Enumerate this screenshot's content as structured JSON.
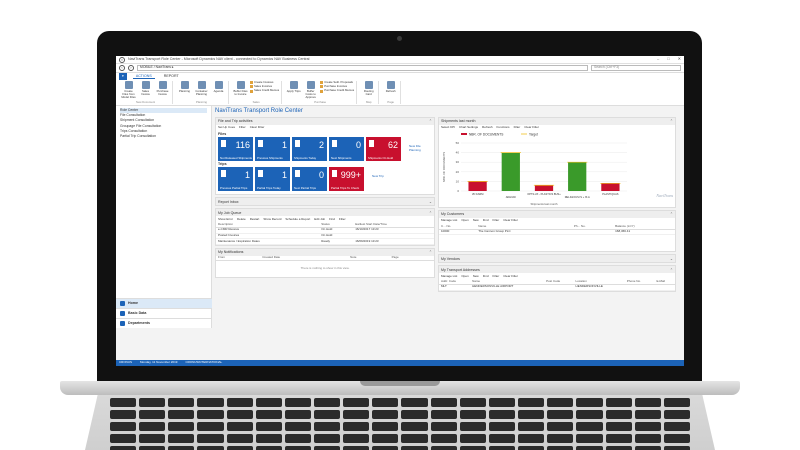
{
  "window": {
    "title": "NaviTrans Transport Role Center - Microsoft Dynamics NAV client - connected to Dynamics NAV Business Central",
    "address": "MOBILE / NaviTrans ▸",
    "search_placeholder": "Search (Ctrl+F3)"
  },
  "ribbon": {
    "tabs": [
      "ACTIONS",
      "REPORT"
    ],
    "groups": [
      {
        "name": "New Document",
        "buttons": [
          "Create Files from Model Files",
          "Sales Invoice",
          "Purchase Invoice"
        ]
      },
      {
        "name": "Planning",
        "buttons": [
          "Planning",
          "Container Planning",
          "Agenda"
        ]
      },
      {
        "name": "Sales",
        "buttons": [
          "Buffer Files to Invoice"
        ],
        "small": [
          "Create Invoices",
          "Sales Invoices",
          "Sales Credit Memos"
        ]
      },
      {
        "name": "Purchase",
        "buttons": [
          "Apply Trips",
          "Buffer Costs to Approve"
        ],
        "small": [
          "Create Settl. Proposals",
          "Purchase Invoices",
          "Purchase Credit Memos"
        ]
      },
      {
        "name": "Map",
        "buttons": [
          "Routing Card"
        ]
      },
      {
        "name": "Page",
        "buttons": [
          "Refresh"
        ]
      }
    ]
  },
  "sidebar": {
    "items": [
      "Role Center",
      "File Consultation",
      "Shipment Consultation",
      "Groupage File Consultation",
      "Trips Consultation",
      "Partial Trip Consultation"
    ],
    "bottom": [
      "Home",
      "Basic Data",
      "Departments"
    ]
  },
  "page_title": "NaviTrans Transport Role Center",
  "file_trip": {
    "header": "File and Trip activities",
    "actions": [
      "Set Up Cues",
      "Filter",
      "Clear Filter"
    ],
    "files_label": "Files",
    "files_tiles": [
      {
        "value": "116",
        "label": "Not Released Shipments",
        "color": "#1c63b7"
      },
      {
        "value": "1",
        "label": "Previous Shipments",
        "color": "#1c63b7"
      },
      {
        "value": "2",
        "label": "Shipments Today",
        "color": "#1c63b7"
      },
      {
        "value": "0",
        "label": "Next Shipments",
        "color": "#1c63b7"
      },
      {
        "value": "62",
        "label": "Shipments On Hold",
        "color": "#c8102e"
      }
    ],
    "files_link": "New File Planning",
    "trips_label": "Trips",
    "trips_tiles": [
      {
        "value": "1",
        "label": "Previous Partial Trips",
        "color": "#1c63b7"
      },
      {
        "value": "1",
        "label": "Partial Trips Today",
        "color": "#1c63b7"
      },
      {
        "value": "0",
        "label": "Next Partial Trips",
        "color": "#1c63b7"
      },
      {
        "value": "999+",
        "label": "Partial Trips To Check",
        "color": "#c8102e"
      }
    ],
    "trips_link": "New Trip"
  },
  "report_inbox": {
    "header": "Report Inbox"
  },
  "job_queue": {
    "header": "My Job Queue",
    "actions": [
      "Show Error",
      "Delete",
      "Restart",
      "Show Record",
      "Schedule a Report",
      "Edit Job",
      "Find",
      "Filter"
    ],
    "columns": [
      "Description",
      "Status",
      "Earliest Start Date/Time"
    ],
    "rows": [
      [
        "e-CMR Receive",
        "On Hold",
        "16/10/2017 13:23"
      ],
      [
        "Posted Invoices",
        "On Hold",
        ""
      ],
      [
        "Maintenance / Expiration Dates",
        "Ready",
        "16/09/2019 13:23"
      ]
    ]
  },
  "notifications": {
    "header": "My Notifications",
    "columns": [
      "From",
      "Created Date",
      "Note",
      "Page"
    ],
    "empty": "There is nothing to show in this view."
  },
  "shipments_chart": {
    "header": "Shipments last month",
    "actions": [
      "Select KPI",
      "Chart Settings",
      "Refresh",
      "Functions",
      "Filter",
      "Clear Filter"
    ],
    "watermark": "NaviTrans"
  },
  "chart_data": {
    "type": "bar",
    "categories": [
      "VD FARM",
      "ADHIVAI",
      "OPTILUX - PLASTICS BUS+",
      "RELIGIOUS IS + IS A",
      "PLASTIQUAS"
    ],
    "series": [
      {
        "name": "NBR. OF DOCUMENTS",
        "values": [
          10,
          40,
          6,
          30,
          8
        ],
        "color": "#c8102e"
      },
      {
        "name": "Target",
        "values": [
          10,
          40,
          6,
          30,
          8
        ],
        "color": "#f0c020"
      }
    ],
    "bar_colors": [
      "#c8102e",
      "#3a9a2a",
      "#c8102e",
      "#3a9a2a",
      "#c8102e"
    ],
    "ylabel": "NBR. OF DOCUMENTS",
    "xlabel": "Shipments last month",
    "ylim": [
      0,
      50
    ],
    "yticks": [
      0,
      10,
      20,
      30,
      40,
      50
    ],
    "legend": "top-left"
  },
  "customers": {
    "header": "My Customers",
    "actions": [
      "Manage List",
      "Open",
      "New",
      "Find",
      "Filter",
      "Clear Filter"
    ],
    "columns": [
      "C... No.",
      "Name",
      "Ph... No.",
      "Balance (LCY)"
    ],
    "rows": [
      [
        "10000",
        "The Cannon Group PLC",
        "",
        "168,366.41"
      ]
    ]
  },
  "vendors": {
    "header": "My Vendors"
  },
  "transport_addresses": {
    "header": "My Transport Addresses",
    "actions": [
      "Manage List",
      "Open",
      "New",
      "Find",
      "Filter",
      "Clear Filter"
    ],
    "columns": [
      "Addr. Code",
      "Name",
      "Post Code",
      "Location",
      "Phone No.",
      "E-Mail"
    ],
    "rows": [
      [
        "MLT",
        "HENDERSONVILLE AIRPORT",
        "",
        "HENDERSONVILLE",
        "",
        ""
      ]
    ]
  },
  "status": {
    "company": "CRONUS",
    "date": "Monday, 11 November 2019",
    "user": "CRONUSINTERNATIONAL"
  }
}
